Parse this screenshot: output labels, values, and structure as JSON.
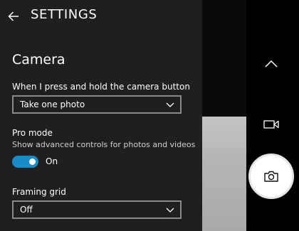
{
  "settings": {
    "title": "SETTINGS",
    "back_icon": "arrow-left-icon",
    "section_title": "Camera",
    "camera_button": {
      "label": "When I press and hold the camera button",
      "value": "Take one photo"
    },
    "pro_mode": {
      "label": "Pro mode",
      "description": "Show advanced controls for photos and videos",
      "state_label": "On",
      "enabled": true
    },
    "framing_grid": {
      "label": "Framing grid",
      "value": "Off"
    }
  },
  "camera": {
    "collapse_icon": "chevron-up-icon",
    "video_icon": "video-camera-icon",
    "shutter_icon": "camera-icon"
  },
  "colors": {
    "panel_background": "#1f1f1f",
    "toggle_on": "#1a8bc7",
    "shutter": "#ffffff"
  }
}
